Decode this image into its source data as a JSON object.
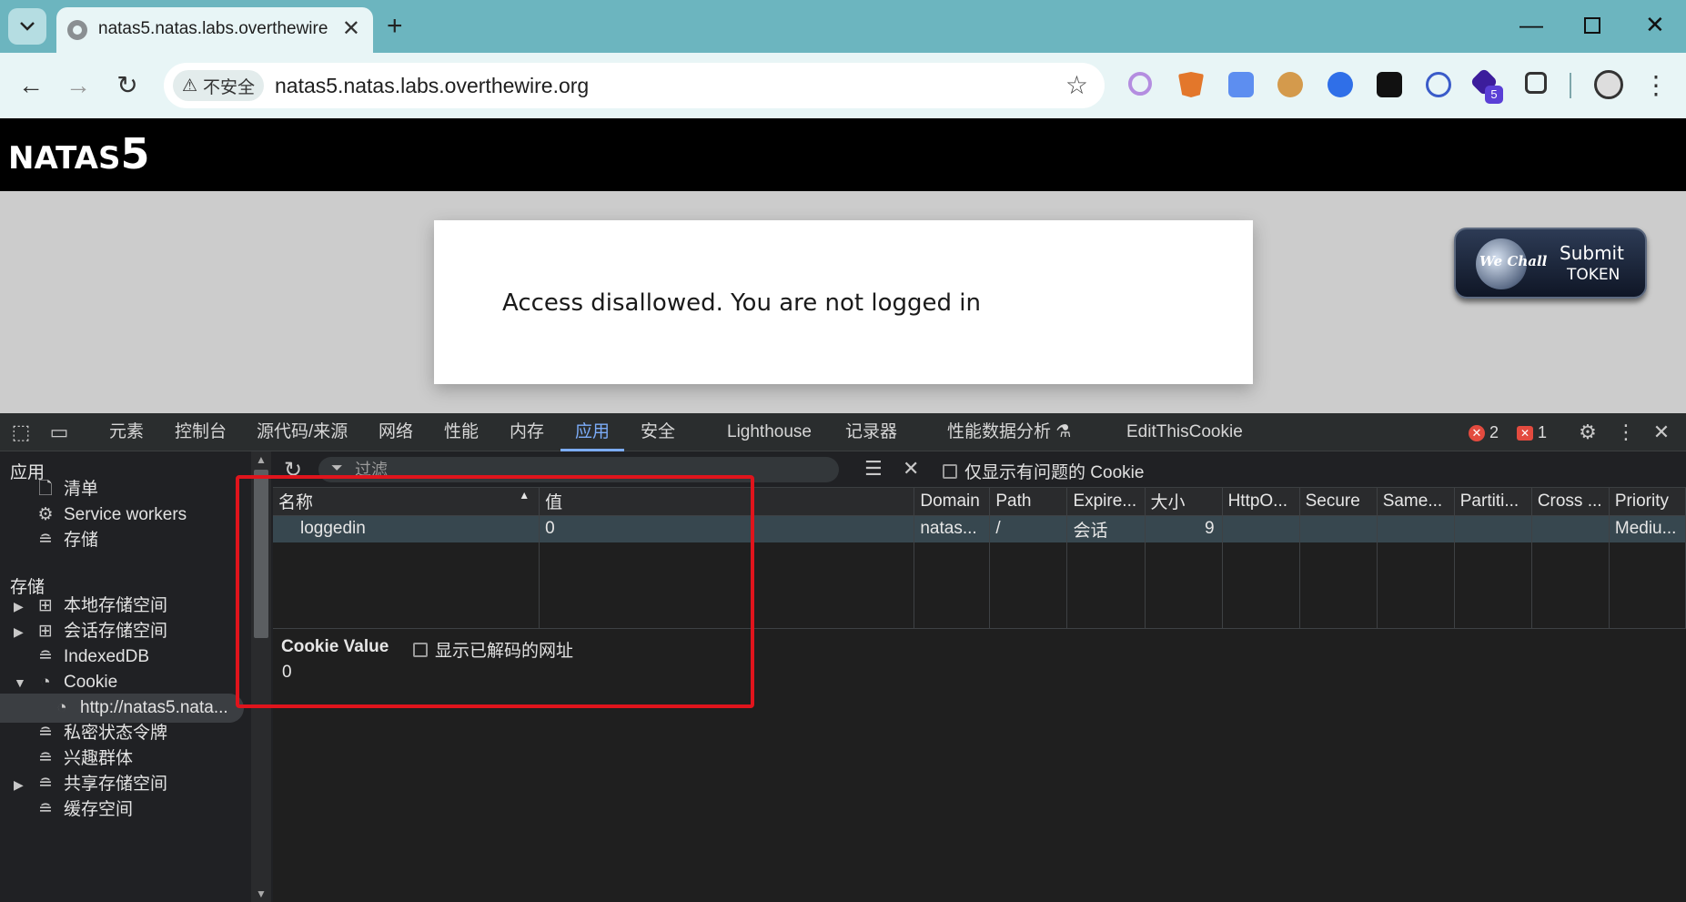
{
  "browser": {
    "tab_title": "natas5.natas.labs.overthewire",
    "security_label": "不安全",
    "url": "natas5.natas.labs.overthewire.org",
    "extensions": [
      "circle-ext-icon",
      "metamask-fox-icon",
      "translate-icon",
      "cookie-ext-icon",
      "blue-c-icon",
      "eyes-icon",
      "password-lock-icon",
      "hexagon-ext-icon",
      "puzzle-icon",
      "profile-avatar-icon"
    ],
    "ext_badge": "5",
    "colors": {
      "tabstrip": "#6cb5bf",
      "toolbar": "#e8f5f6"
    }
  },
  "page": {
    "logo_prefix": "NATAS",
    "logo_level": "5",
    "message": "Access disallowed. You are not logged in",
    "submit_line1": "Submit",
    "submit_line2": "TOKEN",
    "wechall_label": "We Chall"
  },
  "devtools": {
    "tabs": [
      "元素",
      "控制台",
      "源代码/来源",
      "网络",
      "性能",
      "内存",
      "应用",
      "安全",
      "Lighthouse",
      "记录器",
      "性能数据分析",
      "EditThisCookie"
    ],
    "active_tab": "应用",
    "errors_count": "2",
    "issues_count": "1",
    "sidebar": {
      "section_app": "应用",
      "app_items": [
        "清单",
        "Service workers",
        "存储"
      ],
      "section_storage": "存储",
      "storage_items": [
        "本地存储空间",
        "会话存储空间",
        "IndexedDB",
        "Cookie",
        "http://natas5.nata...",
        "私密状态令牌",
        "兴趣群体",
        "共享存储空间",
        "缓存空间"
      ]
    },
    "filter_placeholder": "过滤",
    "only_issues_label": "仅显示有问题的 Cookie",
    "table": {
      "columns": [
        "名称",
        "值",
        "Domain",
        "Path",
        "Expire...",
        "大小",
        "HttpO...",
        "Secure",
        "Same...",
        "Partiti...",
        "Cross ...",
        "Priority"
      ],
      "rows": [
        {
          "name": "loggedin",
          "value": "0",
          "domain": "natas...",
          "path": "/",
          "expires": "会话",
          "size": "9",
          "httponly": "",
          "secure": "",
          "samesite": "",
          "partition": "",
          "cross": "",
          "priority": "Mediu..."
        }
      ]
    },
    "cookie_value_title": "Cookie Value",
    "decode_label": "显示已解码的网址",
    "cookie_value": "0",
    "accent": "#7cacf8",
    "highlight_color": "#e0141c"
  }
}
